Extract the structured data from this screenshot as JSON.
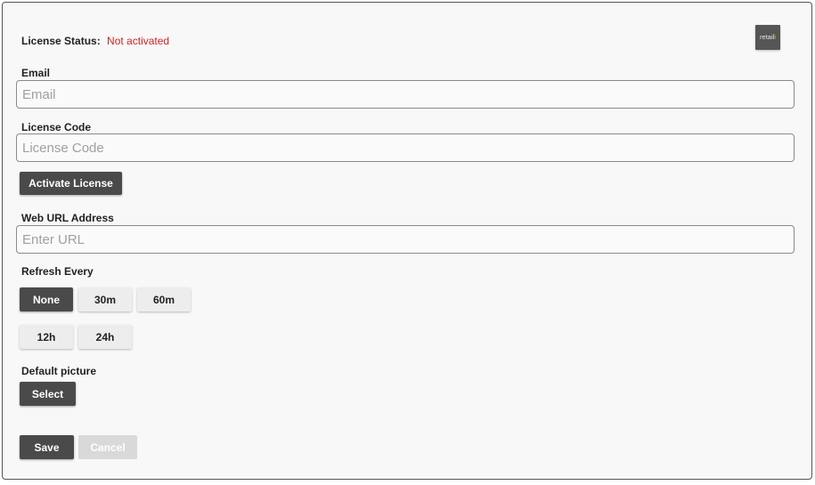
{
  "license": {
    "status_label": "License Status:",
    "status_value": "Not activated",
    "status_color": "#c62828"
  },
  "logo": {
    "text": "retail",
    "dot": "i"
  },
  "email": {
    "label": "Email",
    "placeholder": "Email"
  },
  "license_code": {
    "label": "License Code",
    "placeholder": "License Code"
  },
  "activate_button": "Activate License",
  "web_url": {
    "label": "Web URL Address",
    "placeholder": "Enter URL"
  },
  "refresh": {
    "label": "Refresh Every",
    "selected": "None",
    "options": [
      "None",
      "30m",
      "60m",
      "12h",
      "24h"
    ]
  },
  "default_picture": {
    "label": "Default picture",
    "select_label": "Select"
  },
  "actions": {
    "save": "Save",
    "cancel": "Cancel"
  },
  "colors": {
    "button_dark": "#4a4a4a",
    "button_light": "#ededed",
    "button_disabled": "#d9d9d9"
  }
}
